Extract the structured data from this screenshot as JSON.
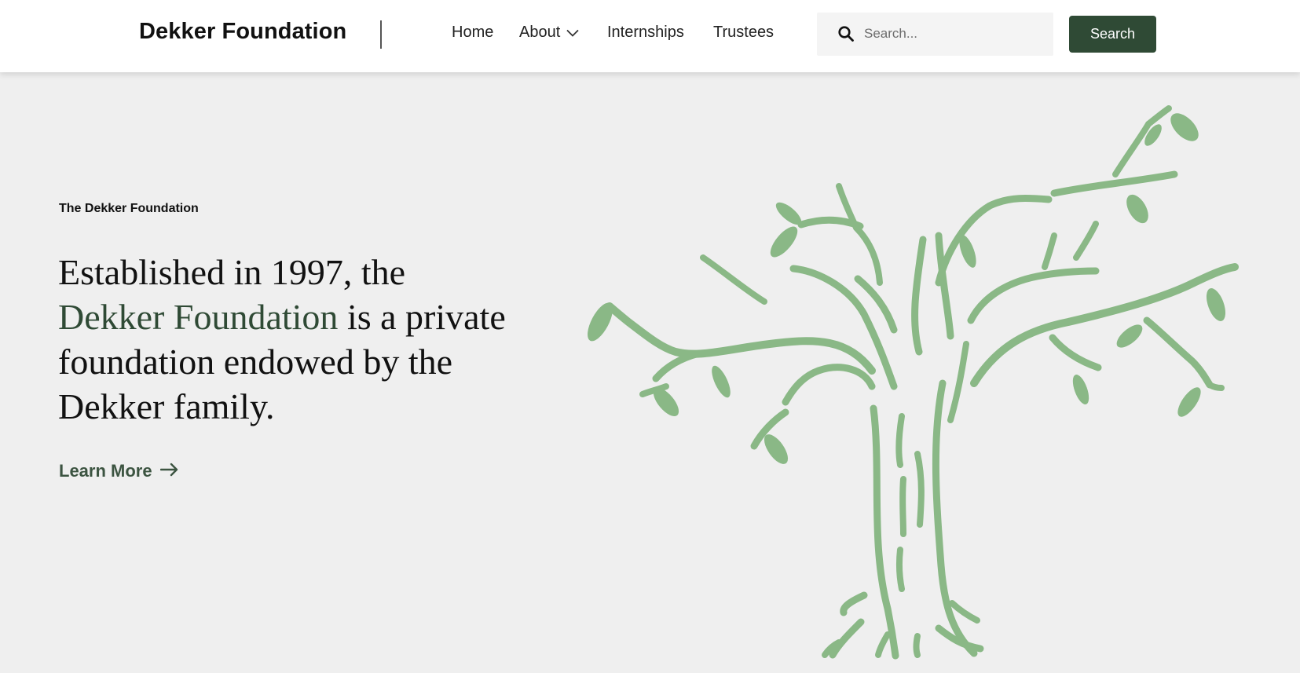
{
  "header": {
    "brand": "Dekker Foundation",
    "nav": [
      {
        "label": "Home"
      },
      {
        "label": "About",
        "has_dropdown": true
      },
      {
        "label": "Internships"
      },
      {
        "label": "Trustees"
      }
    ],
    "search": {
      "placeholder": "Search...",
      "value": "",
      "button_label": "Search",
      "icon": "search-icon"
    }
  },
  "hero": {
    "eyebrow": "The Dekker Foundation",
    "headline_part1": "Established in 1997, the",
    "headline_accent": "Dekker Foundation",
    "headline_part2": " is a private foundation endowed by the Dekker family.",
    "cta_label": "Learn More",
    "cta_icon": "arrow-right-icon",
    "illustration": "tree-illustration"
  },
  "colors": {
    "accent": "#2f4a35",
    "tree": "#8ab886",
    "background": "#efefef",
    "header_bg": "#ffffff"
  }
}
